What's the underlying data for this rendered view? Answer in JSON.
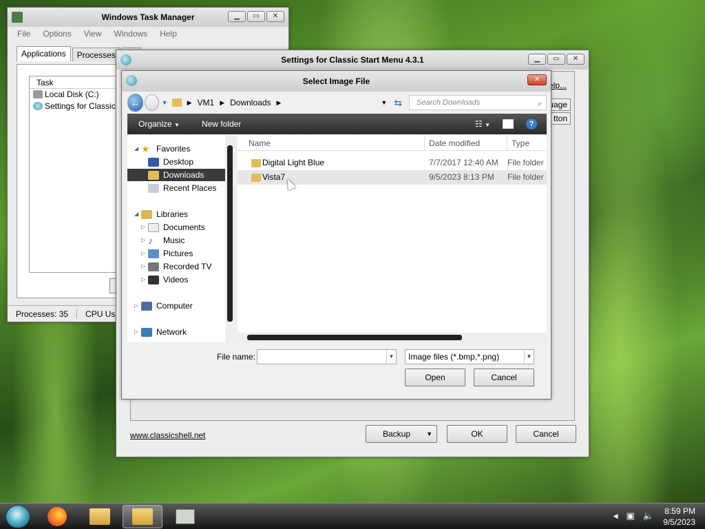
{
  "task_manager": {
    "title": "Windows Task Manager",
    "menu": [
      "File",
      "Options",
      "View",
      "Windows",
      "Help"
    ],
    "tabs": [
      "Applications",
      "Processes",
      "Se"
    ],
    "column_header": "Task",
    "rows": [
      "Local Disk (C:)",
      "Settings for Classic St"
    ],
    "end_button": "E",
    "status_processes": "Processes: 35",
    "status_cpu": "CPU Usa"
  },
  "settings_window": {
    "title": "Settings for Classic Start Menu 4.3.1",
    "help_link": "elp...",
    "side_buttons": [
      "uage",
      "tton"
    ],
    "website_link": "www.classicshell.net",
    "backup_button": "Backup",
    "ok_button": "OK",
    "cancel_button": "Cancel"
  },
  "dialog": {
    "title": "Select Image File",
    "breadcrumb": [
      "VM1",
      "Downloads"
    ],
    "search_placeholder": "Search Downloads",
    "organize_label": "Organize",
    "new_folder_label": "New folder",
    "nav": {
      "favorites": "Favorites",
      "desktop": "Desktop",
      "downloads": "Downloads",
      "recent_places": "Recent Places",
      "libraries": "Libraries",
      "documents": "Documents",
      "music": "Music",
      "pictures": "Pictures",
      "recorded_tv": "Recorded TV",
      "videos": "Videos",
      "computer": "Computer",
      "network": "Network"
    },
    "columns": {
      "name": "Name",
      "date": "Date modified",
      "type": "Type"
    },
    "files": [
      {
        "name": "Digital Light Blue",
        "date": "7/7/2017 12:40 AM",
        "type": "File folder"
      },
      {
        "name": "Vista7",
        "date": "9/5/2023 8:13 PM",
        "type": "File folder"
      }
    ],
    "file_name_label": "File name:",
    "file_name_value": "",
    "file_type": "Image files (*.bmp,*.png)",
    "open_button": "Open",
    "cancel_button": "Cancel"
  },
  "taskbar": {
    "time": "8:59 PM",
    "date": "9/5/2023"
  }
}
